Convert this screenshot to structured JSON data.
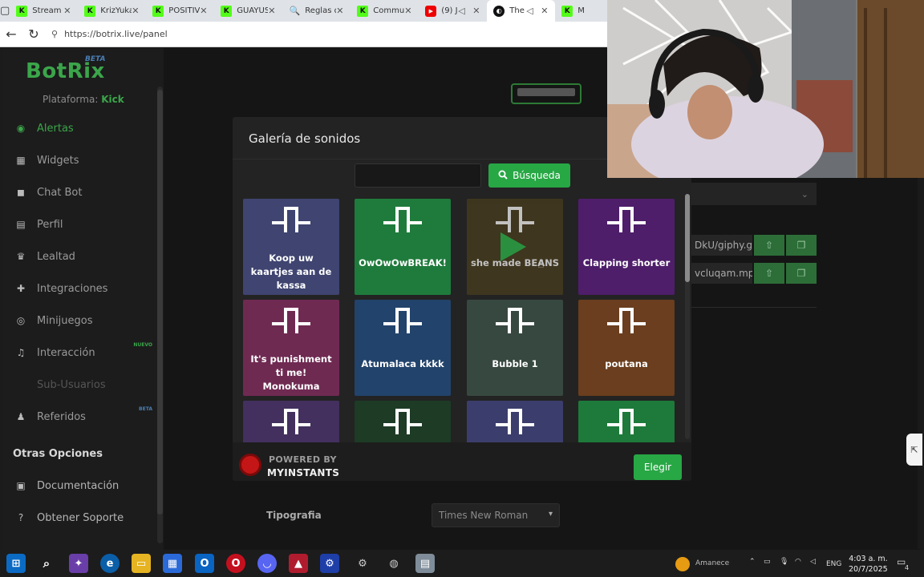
{
  "browser": {
    "tabs": [
      {
        "label": "Stream",
        "favicon": "kick"
      },
      {
        "label": "KrizYuka",
        "favicon": "kick"
      },
      {
        "label": "POSITIV",
        "favicon": "kick"
      },
      {
        "label": "GUAYUS",
        "favicon": "kick"
      },
      {
        "label": "Reglas d",
        "favicon": "search"
      },
      {
        "label": "Commu",
        "favicon": "kick"
      },
      {
        "label": "(9) J",
        "favicon": "youtube"
      },
      {
        "label": "The",
        "favicon": "botrix",
        "active": true
      },
      {
        "label": "M",
        "favicon": "kick"
      }
    ],
    "url": "https://botrix.live/panel"
  },
  "sidebar": {
    "logo": "BotRix",
    "logo_badge": "BETA",
    "platform_label": "Plataforma:",
    "platform_value": "Kick",
    "items": [
      {
        "label": "Alertas",
        "icon": "alert-icon",
        "active": true
      },
      {
        "label": "Widgets",
        "icon": "widgets-icon"
      },
      {
        "label": "Chat Bot",
        "icon": "robot-icon"
      },
      {
        "label": "Perfil",
        "icon": "profile-card-icon"
      },
      {
        "label": "Lealtad",
        "icon": "trophy-icon"
      },
      {
        "label": "Integraciones",
        "icon": "puzzle-icon"
      },
      {
        "label": "Minijuegos",
        "icon": "gamepad-icon"
      },
      {
        "label": "Interacción",
        "icon": "music-note-icon",
        "badge": "NUEVO"
      },
      {
        "label": "Sub-Usuarios",
        "icon": "none",
        "dim": true
      },
      {
        "label": "Referidos",
        "icon": "users-icon",
        "badge": "BETA"
      }
    ],
    "section_title": "Otras Opciones",
    "other_items": [
      {
        "label": "Documentación",
        "icon": "book-icon"
      },
      {
        "label": "Obtener Soporte",
        "icon": "help-icon"
      }
    ]
  },
  "background": {
    "file_rows": [
      "DkU/giphy.g",
      "vcluqam.mp"
    ],
    "tipografia_label": "Tipografia",
    "tipografia_value": "Times New Roman"
  },
  "modal": {
    "title": "Galería de sonidos",
    "search_value": "",
    "search_button": "Búsqueda",
    "sounds": [
      {
        "label": "Koop uw kaartjes aan de kassa",
        "color": "#3f4470"
      },
      {
        "label": "OwOwOwBREAK!",
        "color": "#1f7b3c"
      },
      {
        "label": "she made BEANS",
        "color": "#4a3e1e",
        "playing": true
      },
      {
        "label": "Clapping shorter",
        "color": "#4e1e6a"
      },
      {
        "label": "It's punishment ti me! Monokuma",
        "color": "#6f2a52"
      },
      {
        "label": "Atumalaca kkkk",
        "color": "#22436b"
      },
      {
        "label": "Bubble 1",
        "color": "#374840"
      },
      {
        "label": "poutana",
        "color": "#6a3e1e"
      },
      {
        "label": "",
        "color": "#43305e"
      },
      {
        "label": "",
        "color": "#1d3b25"
      },
      {
        "label": "",
        "color": "#3b3e6c"
      },
      {
        "label": "",
        "color": "#1e7a3a"
      }
    ],
    "powered_by": "POWERED BY",
    "provider": "MYINSTANTS",
    "select_button": "Elegir"
  },
  "taskbar": {
    "weather": "Amanece",
    "language": "ENG",
    "time": "4:03 a. m.",
    "date": "20/7/2025",
    "notifications": "4"
  }
}
